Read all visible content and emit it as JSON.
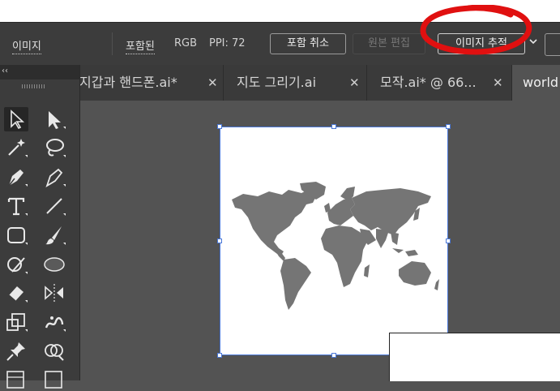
{
  "control_bar": {
    "image_label": "이미지",
    "embedded_label": "포함된",
    "color_mode": "RGB",
    "ppi": "PPI: 72",
    "unembed_button": "포함 취소",
    "edit_original_button": "원본 편집",
    "image_trace_button": "이미지 추적"
  },
  "tabs": [
    {
      "label": "지갑과 핸드폰.ai*"
    },
    {
      "label": "지도 그리기.ai"
    },
    {
      "label": "모작.ai* @ 66..."
    },
    {
      "label": "world"
    }
  ],
  "tab_close_glyph": "✕",
  "tool_panel": {
    "collapse_glyph": "‹‹"
  },
  "colors": {
    "annotation_circle": "#e01010",
    "selection": "#4a78d8",
    "map_fill": "#757575"
  }
}
